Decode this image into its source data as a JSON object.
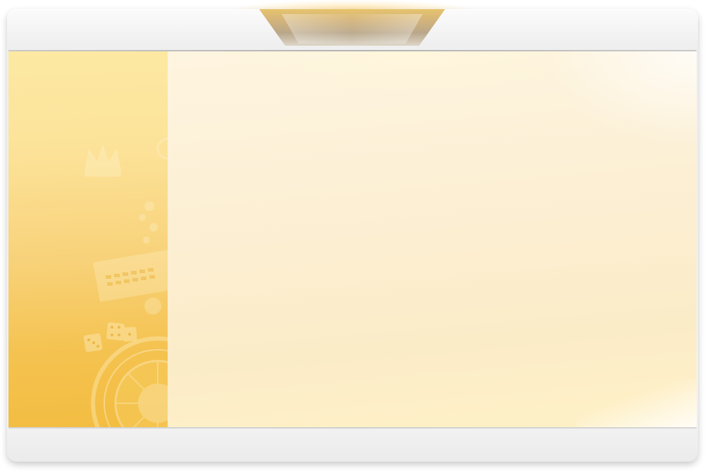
{
  "window": {
    "style": "empty-dialog-frame",
    "accent_color": "#f4c24f",
    "content_color": "#fdf0cf",
    "frame_color": "#f2f2f2"
  },
  "top_tab": {
    "icon": "tab-notch-icon"
  },
  "side_panel": {
    "art_icons": [
      "crown-icon",
      "casino-chips-icon",
      "dice-icon",
      "roulette-wheel-icon"
    ]
  },
  "main_panel": {}
}
